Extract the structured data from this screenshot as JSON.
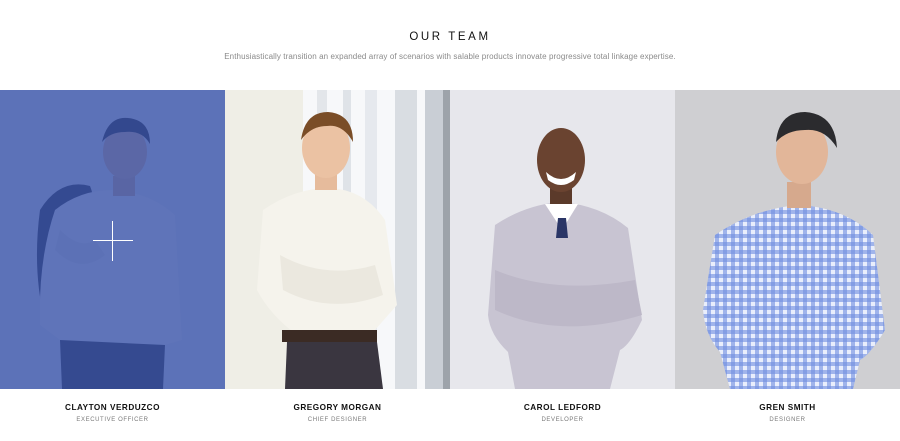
{
  "section": {
    "title": "OUR TEAM",
    "subtitle": "Enthusiastically transition an expanded array of scenarios with salable products innovate progressive total linkage expertise."
  },
  "members": [
    {
      "name": "CLAYTON VERDUZCO",
      "role": "EXECUTIVE OFFICER",
      "hovered": true,
      "overlay_color": "#3a54aa"
    },
    {
      "name": "GREGORY MORGAN",
      "role": "CHIEF DESIGNER",
      "hovered": false
    },
    {
      "name": "CAROL LEDFORD",
      "role": "DEVELOPER",
      "hovered": false
    },
    {
      "name": "GREN SMITH",
      "role": "DESIGNER",
      "hovered": false
    }
  ],
  "icons": {
    "overlay_icon": "plus-icon"
  }
}
